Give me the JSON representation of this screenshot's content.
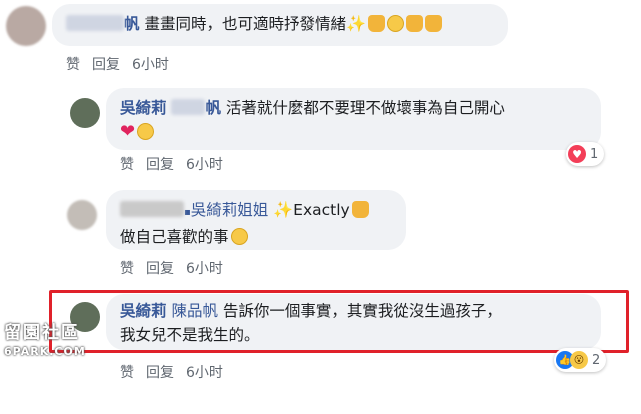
{
  "comments": [
    {
      "author_suffix": "帆",
      "text": "畫畫同時，也可適時抒發情緒",
      "actions": {
        "like": "赞",
        "reply": "回复",
        "time": "6小时"
      }
    },
    {
      "author": "吳綺莉",
      "author_suffix": "帆",
      "text": "活著就什麼都不要理不做壞事為自己開心",
      "actions": {
        "like": "赞",
        "reply": "回复",
        "time": "6小时"
      },
      "reaction_count": "1"
    },
    {
      "author": "吳綺莉姐姐",
      "text_inline": "Exactly",
      "text": "做自己喜歡的事",
      "actions": {
        "like": "赞",
        "reply": "回复",
        "time": "6小时"
      }
    },
    {
      "author": "吳綺莉",
      "mention": "陳品帆",
      "text_line1": "告訴你一個事實，其實我從沒生過孩子，",
      "text_line2": "我女兒不是我生的。",
      "actions": {
        "like": "赞",
        "reply": "回复",
        "time": "6小时"
      },
      "reaction_count": "2"
    }
  ],
  "watermark": {
    "line1": "留園社區",
    "line2": "6PARK.COM"
  },
  "colors": {
    "link": "#385898",
    "bubble": "#f0f2f5",
    "highlight": "#e0212a"
  }
}
